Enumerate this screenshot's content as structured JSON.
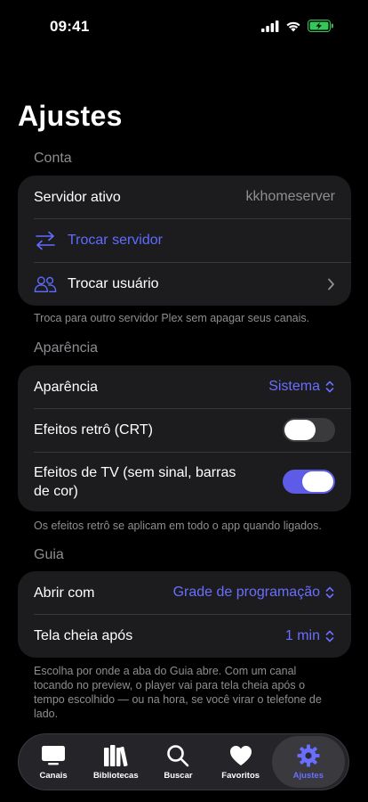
{
  "status_bar": {
    "time": "09:41"
  },
  "page_title": "Ajustes",
  "sections": {
    "account": {
      "header": "Conta",
      "active_server_label": "Servidor ativo",
      "active_server_value": "kkhomeserver",
      "switch_server": "Trocar servidor",
      "switch_user": "Trocar usuário",
      "footer": "Troca para outro servidor Plex sem apagar seus canais."
    },
    "appearance": {
      "header": "Aparência",
      "appearance_label": "Aparência",
      "appearance_value": "Sistema",
      "crt_label": "Efeitos retrô (CRT)",
      "crt_enabled": false,
      "tv_effects_label": "Efeitos de TV (sem sinal, barras de cor)",
      "tv_effects_enabled": true,
      "footer": "Os efeitos retrô se aplicam em todo o app quando ligados."
    },
    "guide": {
      "header": "Guia",
      "open_with_label": "Abrir com",
      "open_with_value": "Grade de programação",
      "fullscreen_after_label": "Tela cheia após",
      "fullscreen_after_value": "1 min",
      "footer": "Escolha por onde a aba do Guia abre. Com um canal tocando no preview, o player vai para tela cheia após o tempo escolhido — ou na hora, se você virar o telefone de lado."
    }
  },
  "tab_bar": {
    "tabs": [
      {
        "label": "Canais",
        "icon": "tv-icon"
      },
      {
        "label": "Bibliotecas",
        "icon": "books-icon"
      },
      {
        "label": "Buscar",
        "icon": "magnifier-icon"
      },
      {
        "label": "Favoritos",
        "icon": "heart-icon"
      },
      {
        "label": "Ajustes",
        "icon": "gear-icon",
        "active": true
      }
    ]
  },
  "colors": {
    "accent": "#5e5ce6",
    "link": "#5e6cff",
    "card": "#1c1c1e",
    "secondary_text": "#8e8e93"
  }
}
